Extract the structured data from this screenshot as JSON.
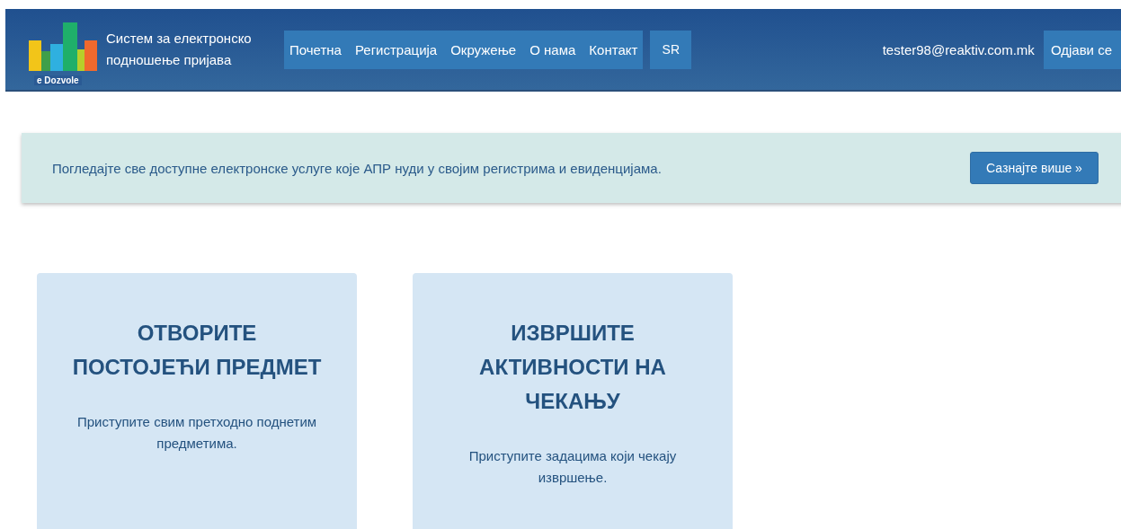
{
  "header": {
    "logo_text": "e Dozvole",
    "title": "Систем за електронско подношење пријава",
    "nav": [
      {
        "label": "Почетна",
        "selected": false
      },
      {
        "label": "Регистрација",
        "selected": false
      },
      {
        "label": "Окружење",
        "selected": false
      },
      {
        "label": "О нама",
        "selected": false
      },
      {
        "label": "Контакт",
        "selected": false
      }
    ],
    "language": "SR",
    "user": "tester98@reaktiv.com.mk",
    "logout": "Одјави се"
  },
  "banner": {
    "text": "Погледајте све доступне електронске услуге које АПР нуди у својим регистрима и евиденцијама.",
    "button": "Сазнајте више »"
  },
  "cards": [
    {
      "title": "ОТВОРИТЕ ПОСТОЈЕЋИ ПРЕДМЕТ",
      "text": "Приступите свим претходно поднетим предметима."
    },
    {
      "title": "ИЗВРШИТЕ АКТИВНОСТИ НА ЧЕКАЊУ",
      "text": "Приступите задацима који чекају извршење."
    }
  ]
}
